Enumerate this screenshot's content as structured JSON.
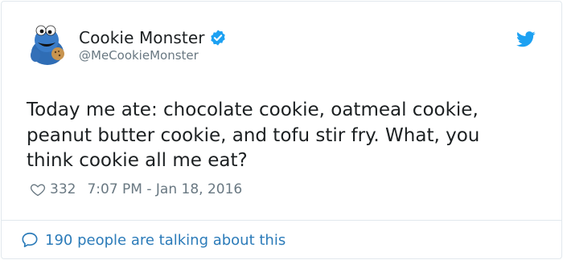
{
  "author": {
    "display_name": "Cookie Monster",
    "handle": "@MeCookieMonster",
    "verified": true
  },
  "tweet": {
    "text": "Today me ate: chocolate cookie, oatmeal cookie, peanut butter cookie, and tofu stir fry. What, you think cookie all me eat?",
    "like_count": "332",
    "timestamp": "7:07 PM - Jan 18, 2016"
  },
  "footer": {
    "conversation_label": "190 people are talking about this"
  },
  "icons": {
    "brand": "twitter-bird-icon",
    "verified": "verified-badge-icon",
    "like": "heart-icon",
    "reply": "speech-bubble-icon"
  },
  "colors": {
    "brand_blue": "#1da1f2",
    "link_blue": "#2b7bb9",
    "muted_gray": "#697882",
    "text": "#1c2022",
    "border": "#e1e8ed"
  }
}
